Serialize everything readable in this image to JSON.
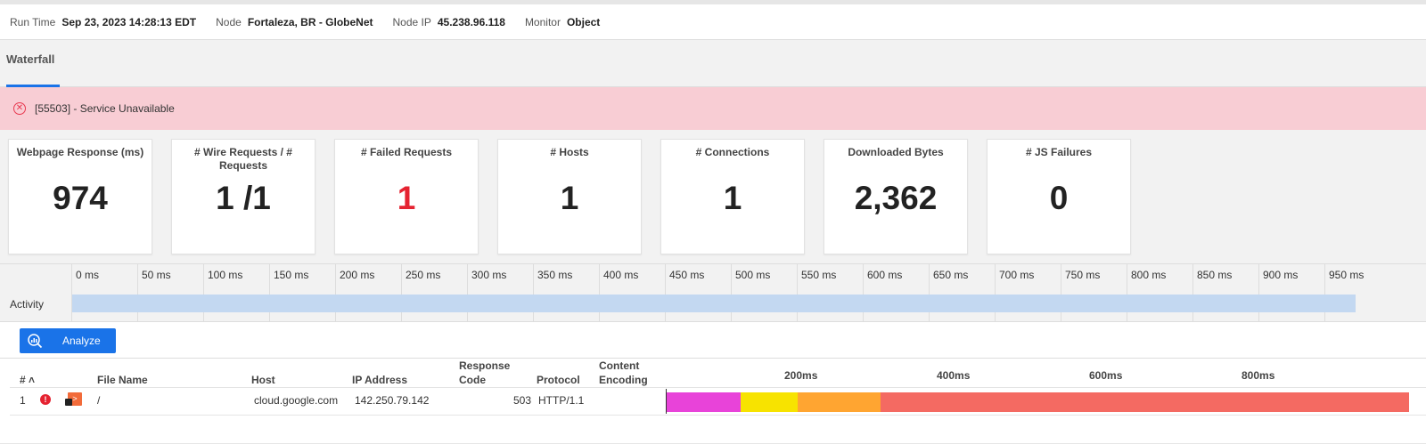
{
  "run_info": {
    "run_time_label": "Run Time",
    "run_time_value": "Sep 23, 2023 14:28:13 EDT",
    "node_label": "Node",
    "node_value": "Fortaleza, BR - GlobeNet",
    "node_ip_label": "Node IP",
    "node_ip_value": "45.238.96.118",
    "monitor_label": "Monitor",
    "monitor_value": "Object"
  },
  "tabs": [
    {
      "label": "Waterfall",
      "active": true
    }
  ],
  "alert": {
    "icon": "error-circle-icon",
    "text": "[55503] - Service Unavailable"
  },
  "cards": [
    {
      "title": "Webpage Response (ms)",
      "value": "974"
    },
    {
      "title": "# Wire Requests / # Requests",
      "value": "1 /1"
    },
    {
      "title": "# Failed Requests",
      "value": "1",
      "color": "#e52331"
    },
    {
      "title": "# Hosts",
      "value": "1"
    },
    {
      "title": "# Connections",
      "value": "1"
    },
    {
      "title": "Downloaded Bytes",
      "value": "2,362"
    },
    {
      "title": "# JS Failures",
      "value": "0"
    }
  ],
  "timeline": {
    "ticks": [
      "0 ms",
      "50 ms",
      "100 ms",
      "150 ms",
      "200 ms",
      "250 ms",
      "300 ms",
      "350 ms",
      "400 ms",
      "450 ms",
      "500 ms",
      "550 ms",
      "600 ms",
      "650 ms",
      "700 ms",
      "750 ms",
      "800 ms",
      "850 ms",
      "900 ms",
      "950 ms"
    ],
    "activity_label": "Activity",
    "activity_color": "#c3d8f1"
  },
  "analyze": {
    "label": "Analyze",
    "icon": "analyze-chart-icon"
  },
  "table": {
    "headers": {
      "num": "# ˄",
      "file_name": "File Name",
      "host": "Host",
      "ip": "IP Address",
      "response_code_1": "Response",
      "response_code_2": "Code",
      "protocol": "Protocol",
      "content_1": "Content",
      "content_2": "Encoding"
    },
    "waterfall_labels": [
      "200ms",
      "400ms",
      "600ms",
      "800ms"
    ],
    "rows": [
      {
        "num": "1",
        "status_icon": "error-icon",
        "file_icon": "html-lock-icon",
        "file_name": "/",
        "host": "cloud.google.com",
        "ip": "142.250.79.142",
        "response_code": "503",
        "protocol": "HTTP/1.1",
        "content_encoding": ""
      }
    ],
    "waterfall_colors": [
      "#e843d9",
      "#f7e300",
      "#ffa531",
      "#f46a62"
    ]
  }
}
